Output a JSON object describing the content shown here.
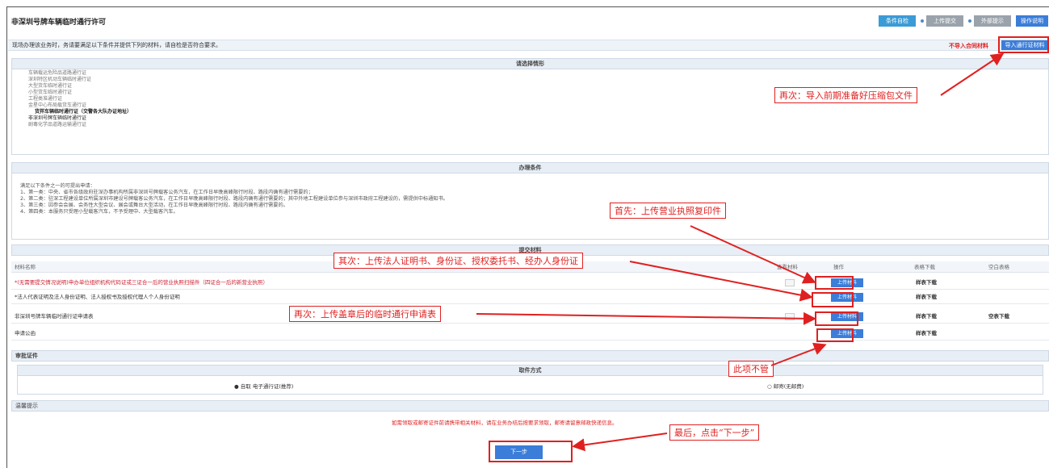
{
  "header": {
    "title": "非深圳号牌车辆临时通行许可",
    "buttons": [
      "条件自检",
      "上传提交",
      "外部提示",
      "操作说明"
    ]
  },
  "notice": {
    "text": "现场办理该业务时，务请要满足以下条件并提供下列的材料，请自检是否符合要求。",
    "red_text": "不导入合同材料",
    "import_label": "导入通行证材料"
  },
  "select_type": {
    "heading": "请选择情形",
    "items": [
      "车辆载运危险品道路通行证",
      "深圳特区机动车辆临时通行证",
      "大型货车临时通行证",
      "小型货车临时通行证",
      "工程类准通行证",
      "金星中心布局载货车通行证",
      "货拌车辆临时通行证（交警各大队办证地址）",
      "非深圳号牌车辆临时通行证",
      "剧毒化学品道路运输通行证"
    ]
  },
  "conditions": {
    "heading": "办理条件",
    "lines": [
      "满足以下条件之一的可提出申请：",
      "1、第一类：中央、省市各级政府驻深办事机构所属非深圳号牌载客公务汽车，在工作日早晚高峰限行时段、路段内确有通行需要的；",
      "2、第二类：驻深工程建设单位所属深圳市建设号牌载客公务汽车，在工作日早晚高峰限行时段、路段内确有通行需要的；其中外地工程建设单位参与深圳市政府工程建设的，需提供中标通知书。",
      "3、第三类：因参会会展、会务性大型会议、展会或舞台大型活动，在工作日早晚高峰限行时段、路段内确有通行需要的。",
      "4、第四类：本服务只受理小型载客汽车，不予受理中、大型载客汽车。"
    ]
  },
  "materials": {
    "heading": "提交材料",
    "columns": [
      "材料名称",
      "查看材料",
      "操作",
      "表格下载",
      "空白表格"
    ],
    "rows": [
      {
        "name": "*(无需要提交情况说明)申办单位组织机构代码证或三证合一后的营业执照扫描件（四证合一后的新营业执照）",
        "op": "上传材料",
        "dl": "样表下载",
        "blank": ""
      },
      {
        "name": "*法人代表证明及法人身份证明、法人授权书及授权代理人个人身份证明",
        "op": "上传材料",
        "dl": "样表下载",
        "blank": ""
      },
      {
        "name": "非深圳号牌车辆临时通行证申请表",
        "op": "上传材料",
        "dl": "样表下载",
        "blank": "空表下载"
      },
      {
        "name": "申请公函",
        "op": "上传材料",
        "dl": "样表下载",
        "blank": ""
      }
    ]
  },
  "approval": {
    "label": "审批证件",
    "method_heading": "取件方式",
    "option_a": "自取 电子通行证(推荐)",
    "option_b": "邮寄(无邮费)"
  },
  "tips": {
    "label": "温馨提示",
    "text": "如需领取或邮寄证件前请携带相关材料，请在业务办结后按要求领取，邮寄请留意邮政快递信息。"
  },
  "next_label": "下一步",
  "callouts": {
    "c1": "再次：导入前期准备好压缩包文件",
    "c2": "首先：上传营业执照复印件",
    "c3": "其次：上传法人证明书、身份证、授权委托书、经办人身份证",
    "c4": "再次：上传盖章后的临时通行申请表",
    "c5": "此项不管",
    "c6": "最后，点击“下一步”"
  },
  "colors": {
    "accent": "#3b7dd8",
    "annotation": "#e02020"
  }
}
